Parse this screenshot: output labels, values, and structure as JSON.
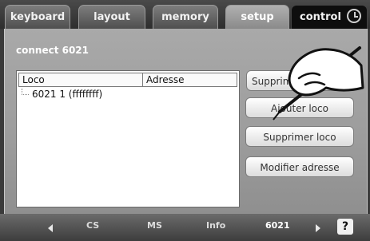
{
  "tabs": [
    {
      "label": "keyboard"
    },
    {
      "label": "layout"
    },
    {
      "label": "memory"
    },
    {
      "label": "setup"
    },
    {
      "label": "control"
    }
  ],
  "panel": {
    "title": "connect 6021",
    "list": {
      "columns": [
        "Loco",
        "Adresse"
      ],
      "rows": [
        {
          "loco": "6021 1 (ffffffff)"
        }
      ]
    },
    "buttons": {
      "b1": "Supprimer",
      "b2": "Ajouter loco",
      "b3": "Supprimer loco",
      "b4": "Modifier adresse"
    }
  },
  "statusbar": {
    "cs": "CS",
    "ms": "MS",
    "info": "Info",
    "device": "6021",
    "help": "?"
  }
}
